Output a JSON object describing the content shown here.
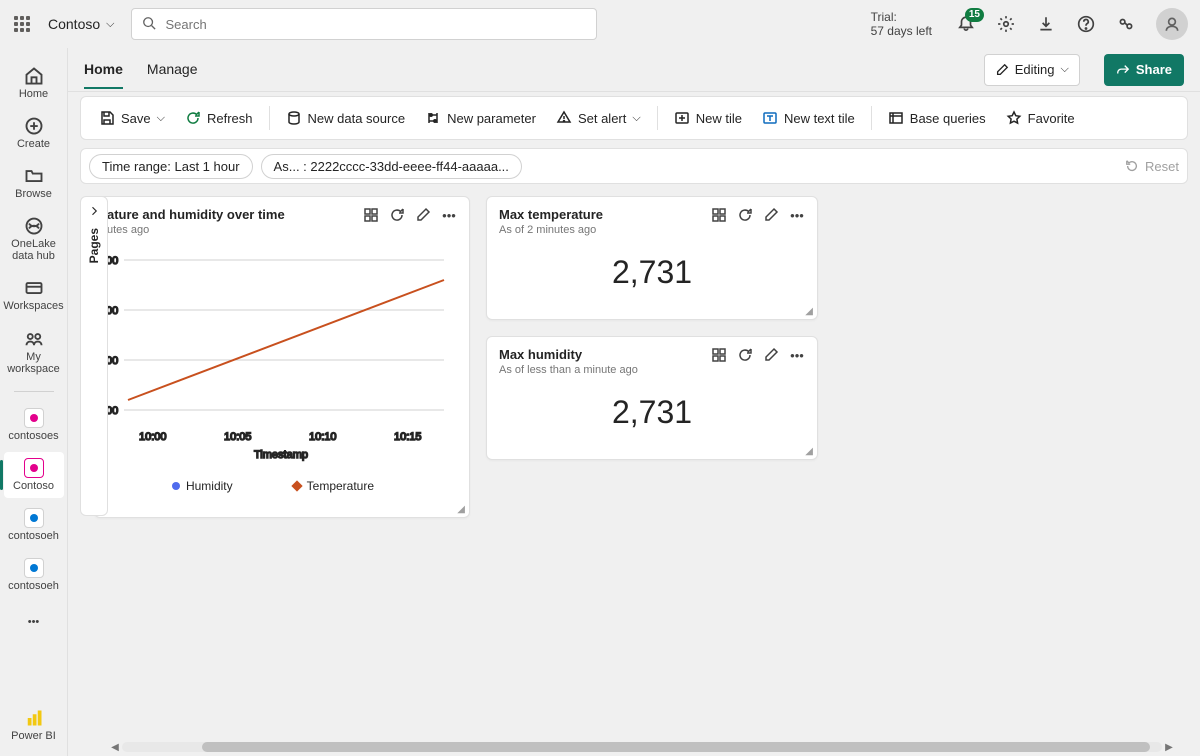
{
  "topbar": {
    "brand": "Contoso",
    "search_placeholder": "Search",
    "trial_label": "Trial:",
    "trial_days": "57 days left",
    "notification_count": "15"
  },
  "leftnav": {
    "items": [
      {
        "label": "Home",
        "icon": "home"
      },
      {
        "label": "Create",
        "icon": "plus-circle"
      },
      {
        "label": "Browse",
        "icon": "folder"
      },
      {
        "label": "OneLake data hub",
        "icon": "onelake"
      },
      {
        "label": "Workspaces",
        "icon": "workspaces"
      },
      {
        "label": "My workspace",
        "icon": "my-workspace"
      },
      {
        "label": "contosoes",
        "icon": "pink-square"
      },
      {
        "label": "Contoso",
        "icon": "pink-square",
        "active": true
      },
      {
        "label": "contosoeh",
        "icon": "blue-square"
      },
      {
        "label": "contosoeh",
        "icon": "blue-square"
      }
    ],
    "footer": "Power BI"
  },
  "tabs": {
    "active": "Home",
    "other": "Manage",
    "editing": "Editing",
    "share": "Share"
  },
  "toolbar": {
    "save": "Save",
    "refresh": "Refresh",
    "new_data_source": "New data source",
    "new_parameter": "New parameter",
    "set_alert": "Set alert",
    "new_tile": "New tile",
    "new_text_tile": "New text tile",
    "base_queries": "Base queries",
    "favorite": "Favorite"
  },
  "filters": {
    "time_range": "Time range: Last 1 hour",
    "asset": "As... : 2222cccc-33dd-eeee-ff44-aaaaa...",
    "reset": "Reset"
  },
  "pages_label": "Pages",
  "tiles": {
    "chart": {
      "title": "ature and humidity over time",
      "subtitle": "utes ago"
    },
    "max_temp": {
      "title": "Max temperature",
      "subtitle": "As of 2 minutes ago",
      "value": "2,731"
    },
    "max_hum": {
      "title": "Max humidity",
      "subtitle": "As of less than a minute ago",
      "value": "2,731"
    }
  },
  "chart_data": {
    "type": "line",
    "title": "Temperature and humidity over time",
    "xlabel": "Timestamp",
    "ylabel": "",
    "x_ticks": [
      "10:00",
      "10:05",
      "10:10",
      "10:15"
    ],
    "y_ticks_suffix": "00",
    "series": [
      {
        "name": "Humidity",
        "color": "#4f6bed"
      },
      {
        "name": "Temperature",
        "color": "#c8501e",
        "points": [
          [
            0,
            0.82
          ],
          [
            1,
            0.18
          ]
        ]
      }
    ],
    "note": "Only the Temperature line is visibly rendered as a straight increasing line across the plot; y-axis labels are clipped showing only '00' suffixes."
  }
}
